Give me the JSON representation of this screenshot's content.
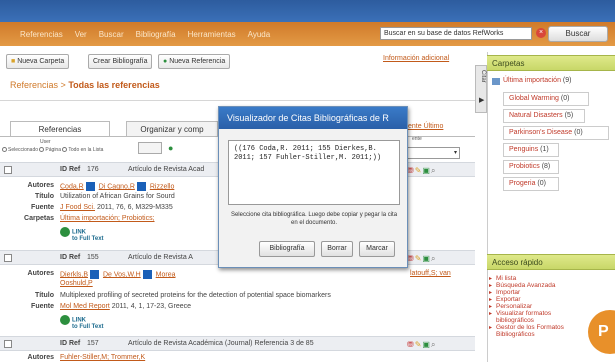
{
  "menu": [
    "Referencias",
    "Ver",
    "Buscar",
    "Bibliografía",
    "Herramientas",
    "Ayuda"
  ],
  "search": {
    "value": "Buscar en su base de datos RefWorks",
    "button": "Buscar"
  },
  "toolbar": {
    "new_folder": "Nueva Carpeta",
    "create_bib": "Crear Bibliografía",
    "new_ref": "Nueva Referencia",
    "info": "Información adicional"
  },
  "breadcrumb": {
    "root": "Referencias",
    "sep": ">",
    "current": "Todas las referencias"
  },
  "tabs": {
    "references": "Referencias",
    "organize": "Organizar y comp"
  },
  "select": {
    "user_label": "User",
    "options": [
      "Seleccionado",
      "Página",
      "Todo en la Lista"
    ],
    "sort_value": "",
    "right_link": "ente Último"
  },
  "records": [
    {
      "label": "ID Ref",
      "id": "176",
      "type": "Artículo de Revista Acad",
      "authors_label": "Autores",
      "authors": [
        "Coda,R",
        "Di Cagno,R",
        "Rizzello"
      ],
      "title_label": "Título",
      "title": "Utilization of African Grains for Sourd",
      "source_label": "Fuente",
      "source_journal": "J Food Sci.",
      "source_rest": "2011, 76, 6, M329-M335",
      "folders_label": "Carpetas",
      "folders": "Última importación; Probiotics;",
      "fulltext_1": "LINK",
      "fulltext_2": "to Full Text"
    },
    {
      "label": "ID Ref",
      "id": "155",
      "type": "Artículo de Revista A",
      "authors_label": "Autores",
      "authors": [
        "Dierkls,B",
        "De Vos,W.H",
        "Morea"
      ],
      "authors_tail": "Ooshuld,P",
      "authors_right": "latouff,S; van",
      "title_label": "Título",
      "title": "Multiplexed profiling of secreted proteins for the detection of potential space biomarkers",
      "source_label": "Fuente",
      "source_journal": "Mol Med Report",
      "source_rest": "2011, 4, 1, 17-23, Greece",
      "fulltext_1": "LINK",
      "fulltext_2": "to Full Text"
    },
    {
      "label": "ID Ref",
      "id": "157",
      "type": "Artículo de Revista Académica (Journal) Referencia 3 de 85",
      "authors_label": "Autores",
      "authors_partial": "Fuhler-Stiller,M; Trommer,K"
    }
  ],
  "modal": {
    "title": "Visualizador de Citas Bibliográficas de R",
    "citation": "((176 Coda,R. 2011; 155 Dierkes,B. 2011; 157 Fuhler-Stiller,M. 2011;))",
    "message": "Seleccione cita bibliográfica. Luego debe copiar y pegar la cita en el documento.",
    "buttons": [
      "Bibliografía",
      "Borrar",
      "Marcar"
    ]
  },
  "sidebar": {
    "tab_label": "Citar",
    "folders_title": "Carpetas",
    "folders": [
      {
        "name": "Última importación",
        "count": "(9)"
      },
      {
        "name": "Global Warming",
        "count": "(0)"
      },
      {
        "name": "Natural Disasters",
        "count": "(5)"
      },
      {
        "name": "Parkinson's Disease",
        "count": "(0)"
      },
      {
        "name": "Penguins",
        "count": "(1)"
      },
      {
        "name": "Probiotics",
        "count": "(8)"
      },
      {
        "name": "Progeria",
        "count": "(0)"
      }
    ],
    "quick_title": "Acceso rápido",
    "quick": [
      "Mi lista",
      "Búsqueda Avanzada",
      "Importar",
      "Exportar",
      "Personalizar",
      "Visualizar formatos",
      "bibliográficos",
      "Gestor de los Formatos",
      "Bibliográficos"
    ]
  },
  "badge": "P",
  "colors": {
    "menu": "#e39a45",
    "header": "#2d5c9e",
    "modal_title": "#3a7bc8",
    "sidebar_head": "#c8d768",
    "link": "#c25a1a"
  }
}
